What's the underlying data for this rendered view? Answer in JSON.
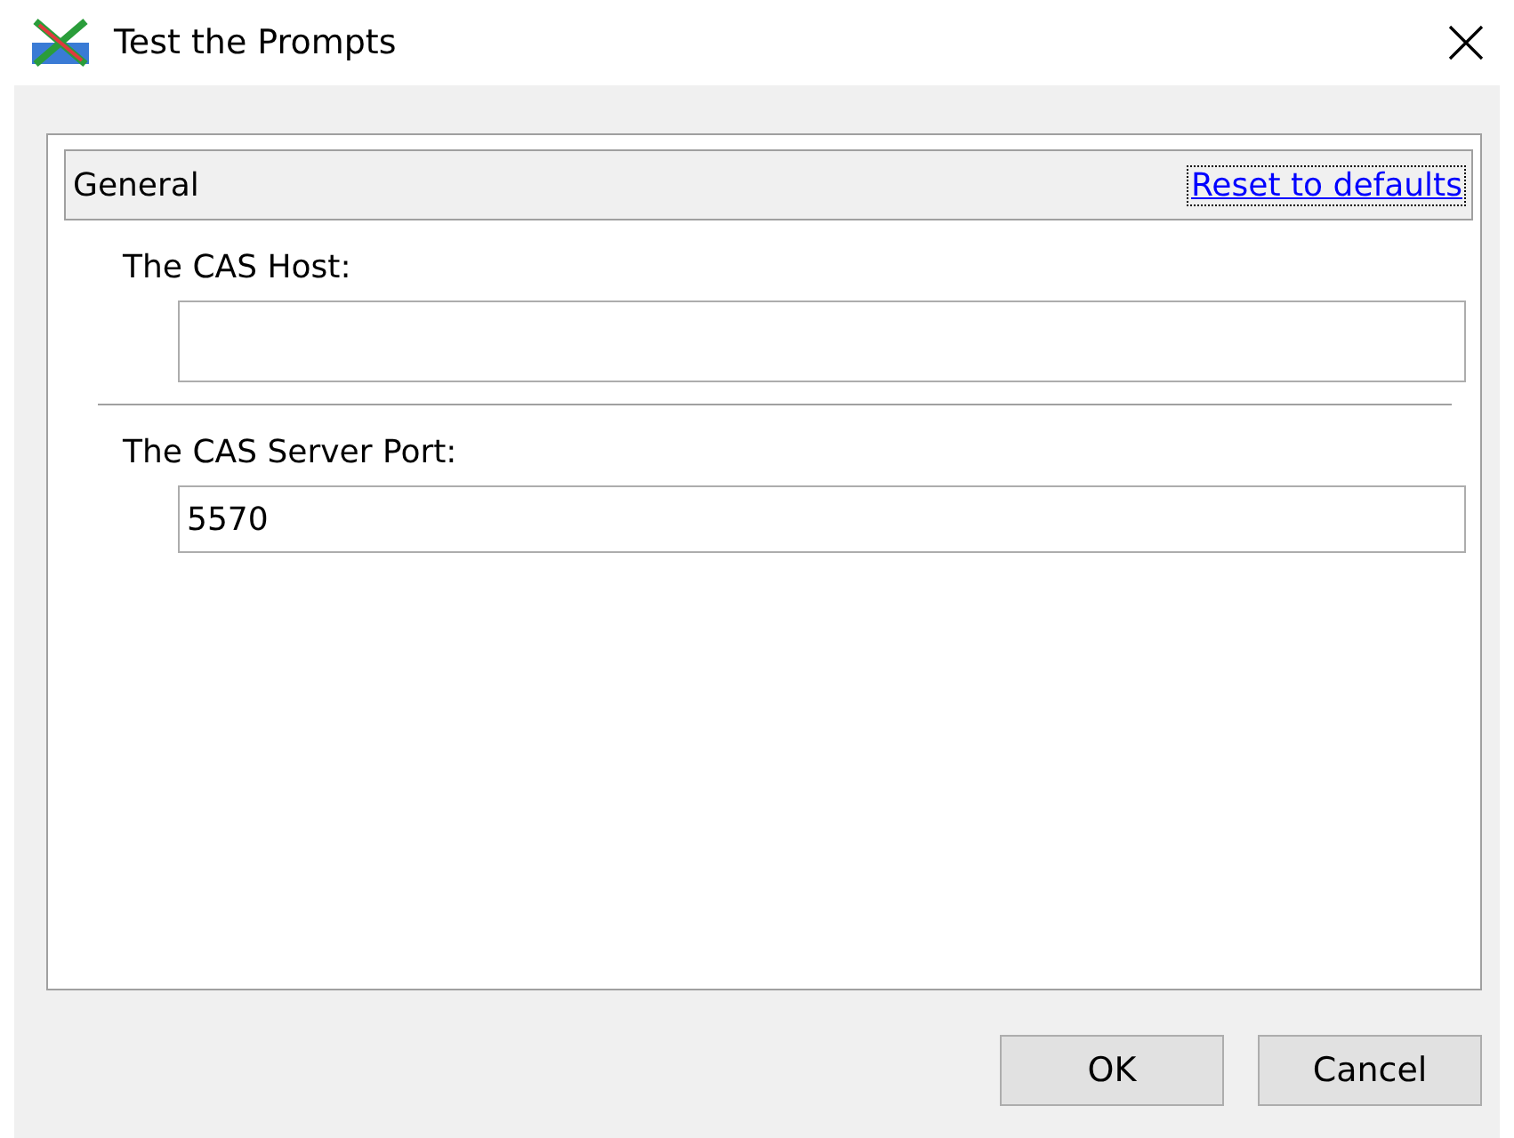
{
  "window": {
    "title": "Test the Prompts"
  },
  "section": {
    "title": "General",
    "link": "Reset to defaults"
  },
  "fields": [
    {
      "label": "The CAS Host:"
    },
    {
      "label": "The CAS Server Port:",
      "value": "5570"
    }
  ],
  "buttons": [
    "OK",
    "Cancel"
  ]
}
